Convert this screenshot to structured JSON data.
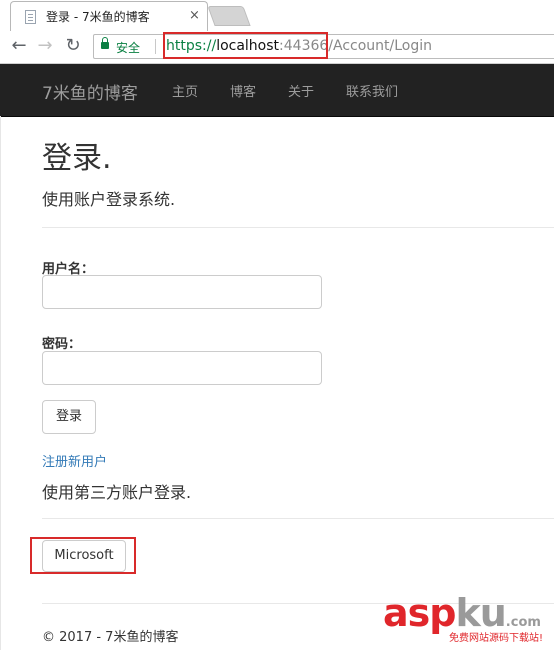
{
  "browser": {
    "tab_title": "登录 - 7米鱼的博客",
    "tab_close": "×",
    "back_glyph": "←",
    "forward_glyph": "→",
    "reload_glyph": "↻",
    "secure_label": "安全",
    "url_scheme": "https://",
    "url_host": "localhost",
    "url_port": ":44366",
    "url_path": "/Account/Login"
  },
  "navbar": {
    "brand": "7米鱼的博客",
    "links": [
      "主页",
      "博客",
      "关于",
      "联系我们"
    ]
  },
  "page": {
    "title": "登录.",
    "subtitle": "使用账户登录系统.",
    "username_label": "用户名：",
    "username_value": "",
    "password_label": "密码：",
    "password_value": "",
    "login_button": "登录",
    "register_link": "注册新用户",
    "external_heading": "使用第三方账户登录.",
    "external_provider_button": "Microsoft"
  },
  "footer": {
    "copyright": "© 2017 - 7米鱼的博客"
  },
  "watermark": {
    "brand_red": "asp",
    "brand_gray": "ku",
    "domain_suffix": ".com",
    "tagline": "免费网站源码下载站!"
  },
  "colors": {
    "navbar_bg": "#222222",
    "nav_text": "#9d9d9d",
    "link": "#337ab7",
    "highlight_box": "#d82a2a",
    "secure_green": "#0b8043"
  }
}
